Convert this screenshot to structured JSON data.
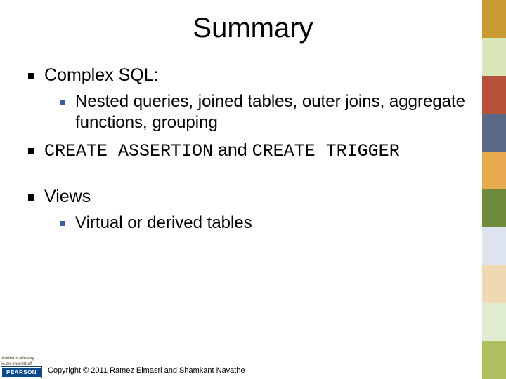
{
  "slide": {
    "title": "Summary",
    "bullets": [
      {
        "level": 1,
        "text_html": "Complex SQL:"
      },
      {
        "level": 2,
        "text_html": "Nested queries, joined tables, outer joins, aggregate functions, grouping"
      },
      {
        "level": 1,
        "text_html": "<span class=\"mono\">CREATE ASSERTION</span> and <span class=\"mono\">CREATE TRIGGER</span>"
      },
      {
        "level": 1,
        "text_html": "Views",
        "gap_before": true
      },
      {
        "level": 2,
        "text_html": "Virtual or derived tables"
      }
    ]
  },
  "footer": {
    "imprint_line1": "Addison-Wesley",
    "imprint_line2": "is an imprint of",
    "publisher": "PEARSON",
    "copyright": "Copyright © 2011 Ramez Elmasri and Shamkant Navathe"
  }
}
